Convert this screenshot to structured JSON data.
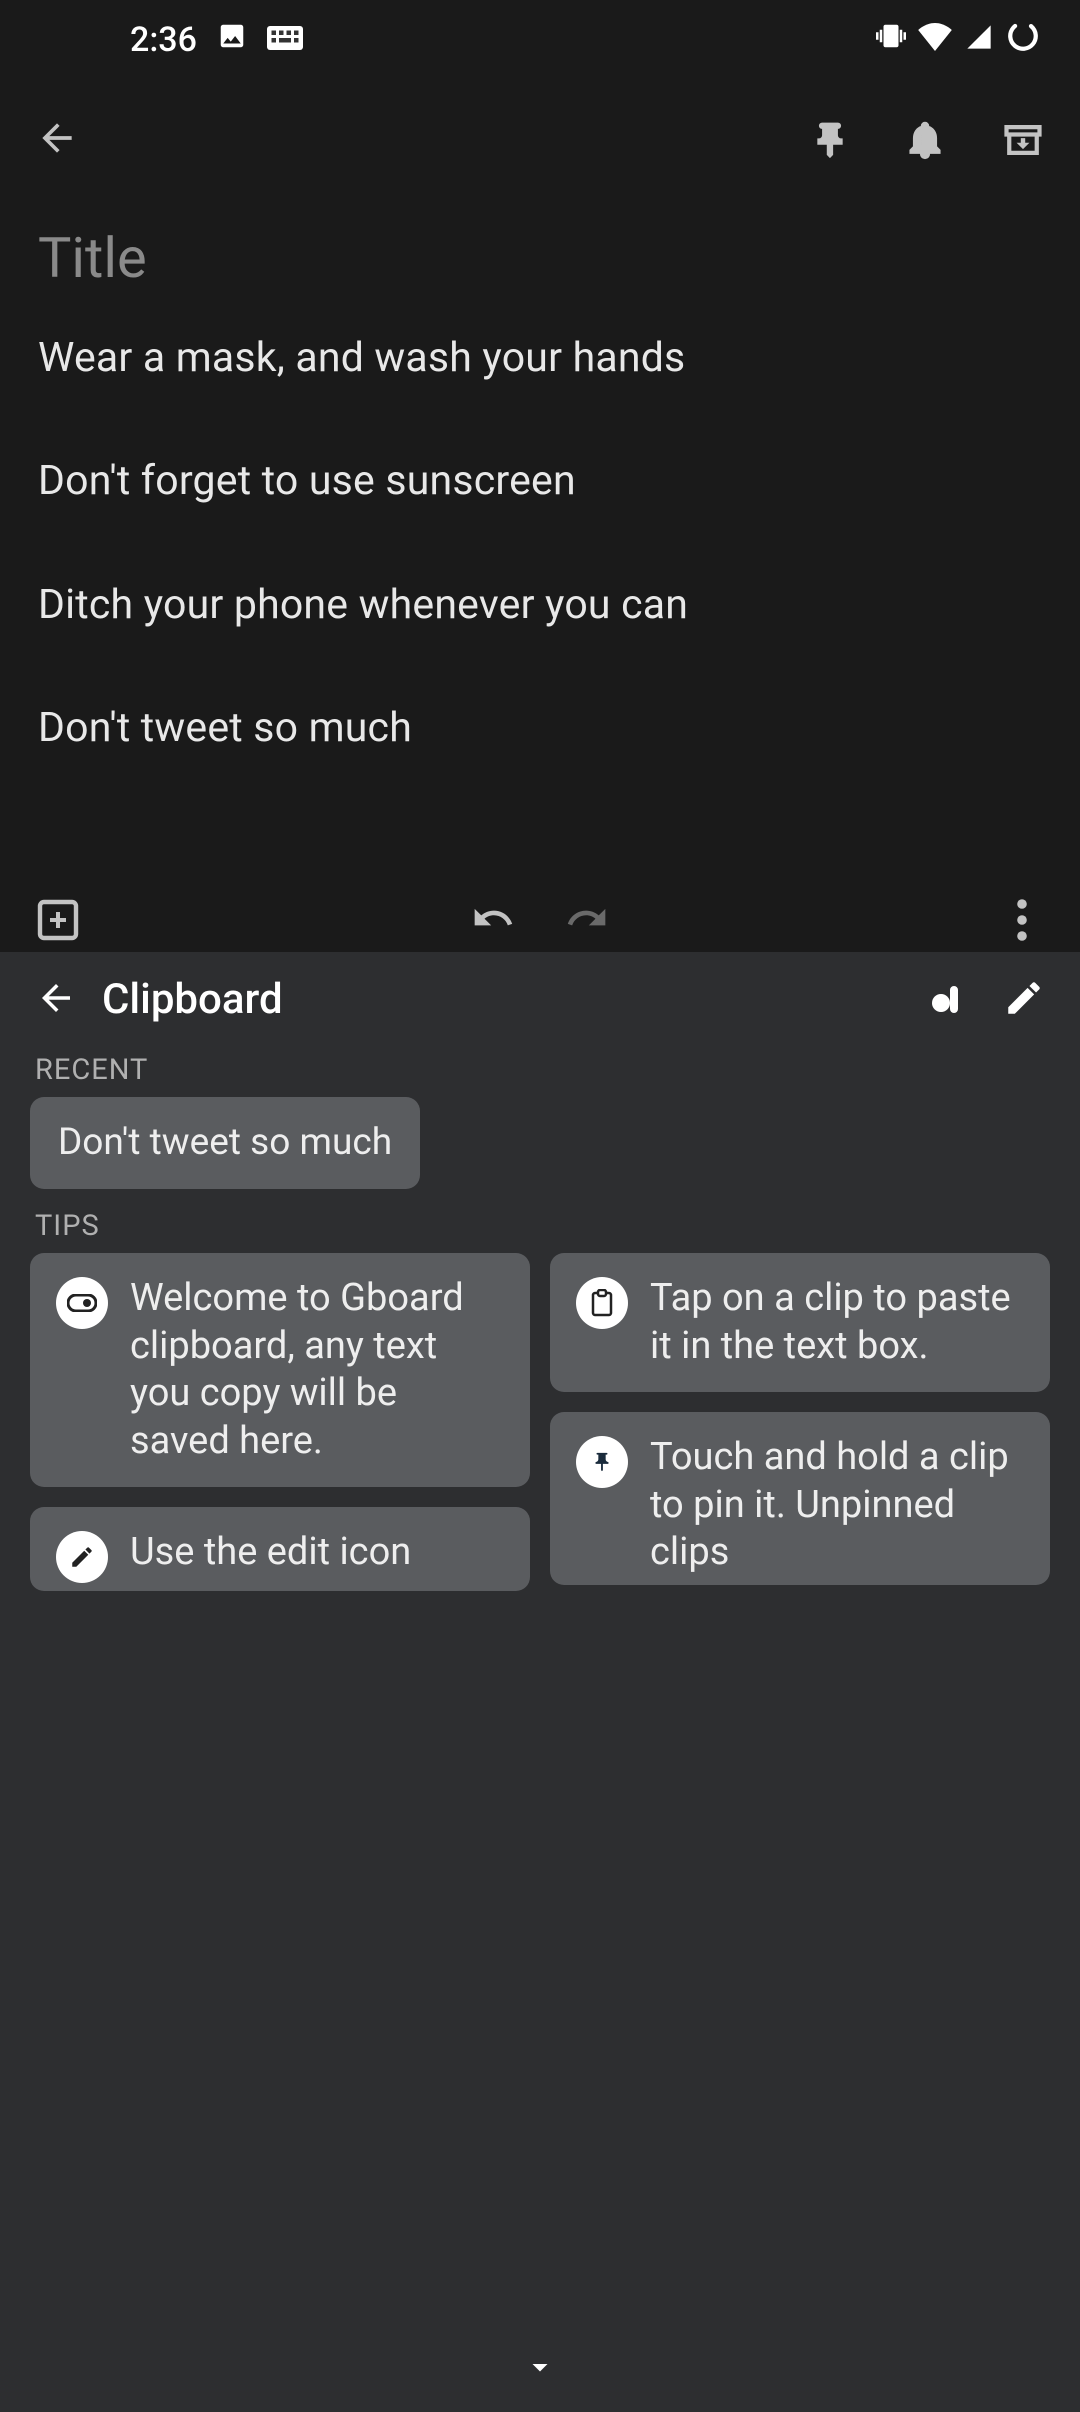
{
  "status": {
    "time": "2:36"
  },
  "note": {
    "title_placeholder": "Title",
    "lines": [
      "Wear a mask, and wash your hands",
      "Don't forget to use sunscreen",
      "Ditch your phone whenever you can",
      "Don't tweet so much"
    ]
  },
  "clipboard": {
    "title": "Clipboard",
    "sections": {
      "recent": "RECENT",
      "tips": "TIPS"
    },
    "recent_items": [
      "Don't tweet so much"
    ],
    "tips": {
      "welcome": "Welcome to Gboard clipboard, any text you copy will be saved here.",
      "edit_partial": "Use the edit icon",
      "paste": "Tap on a clip to paste it in the text box.",
      "pin": "Touch and hold a clip to pin it. Unpinned clips"
    }
  }
}
